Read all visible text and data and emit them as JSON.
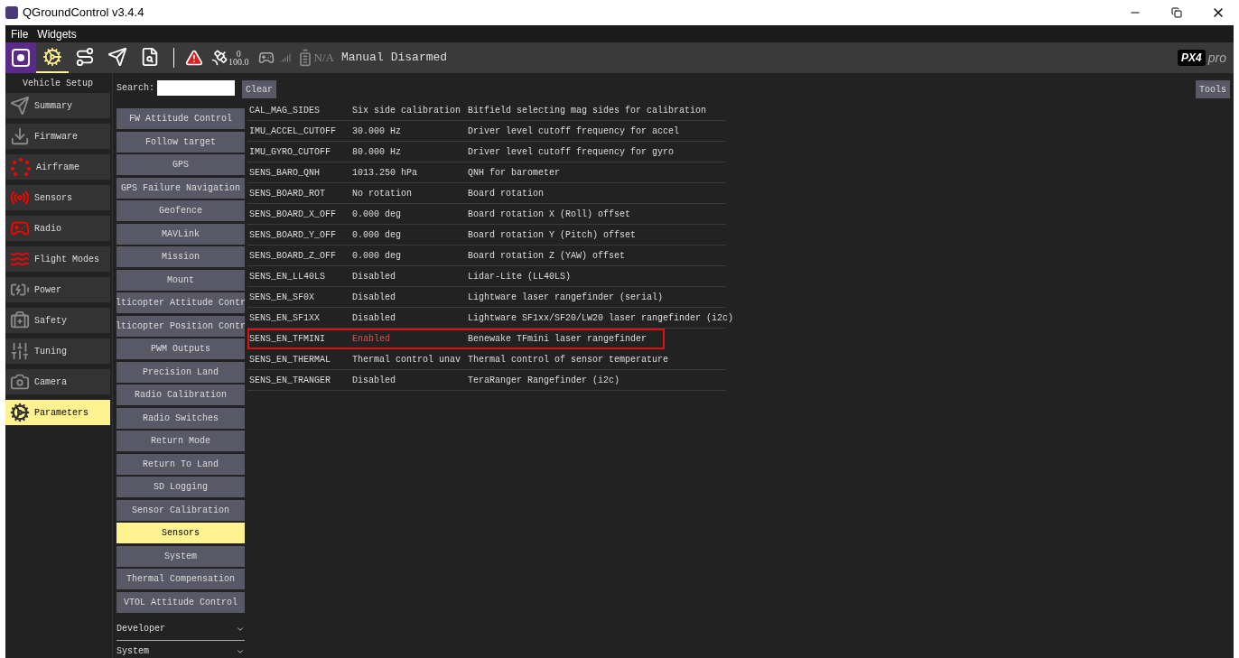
{
  "window": {
    "title": "QGroundControl v3.4.4"
  },
  "menu": [
    "File",
    "Widgets"
  ],
  "toolbar": {
    "views": [
      {
        "kind": "setup",
        "selected": true
      },
      {
        "kind": "plan",
        "selected": false
      },
      {
        "kind": "fly",
        "selected": false
      },
      {
        "kind": "analyze",
        "selected": false
      }
    ],
    "gps_count": "0",
    "hdop": "100.0",
    "battery": "N/A",
    "flight_mode": "Manual",
    "arm_state": "Disarmed"
  },
  "logo": {
    "text": "PX4",
    "suffix": "pro"
  },
  "sidebar": {
    "title": "Vehicle Setup",
    "items": [
      {
        "kind": "summary",
        "label": "Summary",
        "attention": false,
        "selected": false
      },
      {
        "kind": "firmware",
        "label": "Firmware",
        "attention": false,
        "selected": false
      },
      {
        "kind": "airframe",
        "label": "Airframe",
        "attention": true,
        "selected": false
      },
      {
        "kind": "sensors",
        "label": "Sensors",
        "attention": true,
        "selected": false
      },
      {
        "kind": "radio",
        "label": "Radio",
        "attention": true,
        "selected": false
      },
      {
        "kind": "flightmodes",
        "label": "Flight Modes",
        "attention": true,
        "selected": false
      },
      {
        "kind": "power",
        "label": "Power",
        "attention": false,
        "selected": false
      },
      {
        "kind": "safety",
        "label": "Safety",
        "attention": false,
        "selected": false
      },
      {
        "kind": "tuning",
        "label": "Tuning",
        "attention": false,
        "selected": false
      },
      {
        "kind": "camera",
        "label": "Camera",
        "attention": false,
        "selected": false
      },
      {
        "kind": "parameters",
        "label": "Parameters",
        "attention": false,
        "selected": true
      }
    ]
  },
  "search": {
    "label": "Search:",
    "clear": "Clear"
  },
  "tools_button": "Tools",
  "groups": [
    {
      "label": "FW Attitude Control",
      "selected": false
    },
    {
      "label": "Follow target",
      "selected": false
    },
    {
      "label": "GPS",
      "selected": false
    },
    {
      "label": "GPS Failure Navigation",
      "selected": false
    },
    {
      "label": "Geofence",
      "selected": false
    },
    {
      "label": "MAVLink",
      "selected": false
    },
    {
      "label": "Mission",
      "selected": false
    },
    {
      "label": "Mount",
      "selected": false
    },
    {
      "label": "lticopter Attitude Contr",
      "selected": false
    },
    {
      "label": "lticopter Position Contr",
      "selected": false
    },
    {
      "label": "PWM Outputs",
      "selected": false
    },
    {
      "label": "Precision Land",
      "selected": false
    },
    {
      "label": "Radio Calibration",
      "selected": false
    },
    {
      "label": "Radio Switches",
      "selected": false
    },
    {
      "label": "Return Mode",
      "selected": false
    },
    {
      "label": "Return To Land",
      "selected": false
    },
    {
      "label": "SD Logging",
      "selected": false
    },
    {
      "label": "Sensor Calibration",
      "selected": false
    },
    {
      "label": "Sensors",
      "selected": true
    },
    {
      "label": "System",
      "selected": false
    },
    {
      "label": "Thermal Compensation",
      "selected": false
    },
    {
      "label": "VTOL Attitude Control",
      "selected": false
    }
  ],
  "sections": [
    {
      "label": "Developer",
      "expanded": false
    },
    {
      "label": "System",
      "expanded": false
    }
  ],
  "params": [
    {
      "name": "CAL_MAG_SIDES",
      "value": "Six side calibration",
      "description": "Bitfield selecting mag sides for calibration",
      "modified": false,
      "highlighted": false
    },
    {
      "name": "IMU_ACCEL_CUTOFF",
      "value": "30.000 Hz",
      "description": "Driver level cutoff frequency for accel",
      "modified": false,
      "highlighted": false
    },
    {
      "name": "IMU_GYRO_CUTOFF",
      "value": "80.000 Hz",
      "description": "Driver level cutoff frequency for gyro",
      "modified": false,
      "highlighted": false
    },
    {
      "name": "SENS_BARO_QNH",
      "value": "1013.250 hPa",
      "description": "QNH for barometer",
      "modified": false,
      "highlighted": false
    },
    {
      "name": "SENS_BOARD_ROT",
      "value": "No rotation",
      "description": "Board rotation",
      "modified": false,
      "highlighted": false
    },
    {
      "name": "SENS_BOARD_X_OFF",
      "value": "0.000 deg",
      "description": "Board rotation X (Roll) offset",
      "modified": false,
      "highlighted": false
    },
    {
      "name": "SENS_BOARD_Y_OFF",
      "value": "0.000 deg",
      "description": "Board rotation Y (Pitch) offset",
      "modified": false,
      "highlighted": false
    },
    {
      "name": "SENS_BOARD_Z_OFF",
      "value": "0.000 deg",
      "description": "Board rotation Z (YAW) offset",
      "modified": false,
      "highlighted": false
    },
    {
      "name": "SENS_EN_LL40LS",
      "value": "Disabled",
      "description": "Lidar-Lite (LL40LS)",
      "modified": false,
      "highlighted": false
    },
    {
      "name": "SENS_EN_SF0X",
      "value": "Disabled",
      "description": "Lightware laser rangefinder (serial)",
      "modified": false,
      "highlighted": false
    },
    {
      "name": "SENS_EN_SF1XX",
      "value": "Disabled",
      "description": "Lightware SF1xx/SF20/LW20 laser rangefinder (i2c)",
      "modified": false,
      "highlighted": false
    },
    {
      "name": "SENS_EN_TFMINI",
      "value": "Enabled",
      "description": "Benewake TFmini laser rangefinder",
      "modified": true,
      "highlighted": true
    },
    {
      "name": "SENS_EN_THERMAL",
      "value": "Thermal control unav",
      "description": "Thermal control of sensor temperature",
      "modified": false,
      "highlighted": false
    },
    {
      "name": "SENS_EN_TRANGER",
      "value": "Disabled",
      "description": "TeraRanger Rangefinder (i2c)",
      "modified": false,
      "highlighted": false
    }
  ]
}
